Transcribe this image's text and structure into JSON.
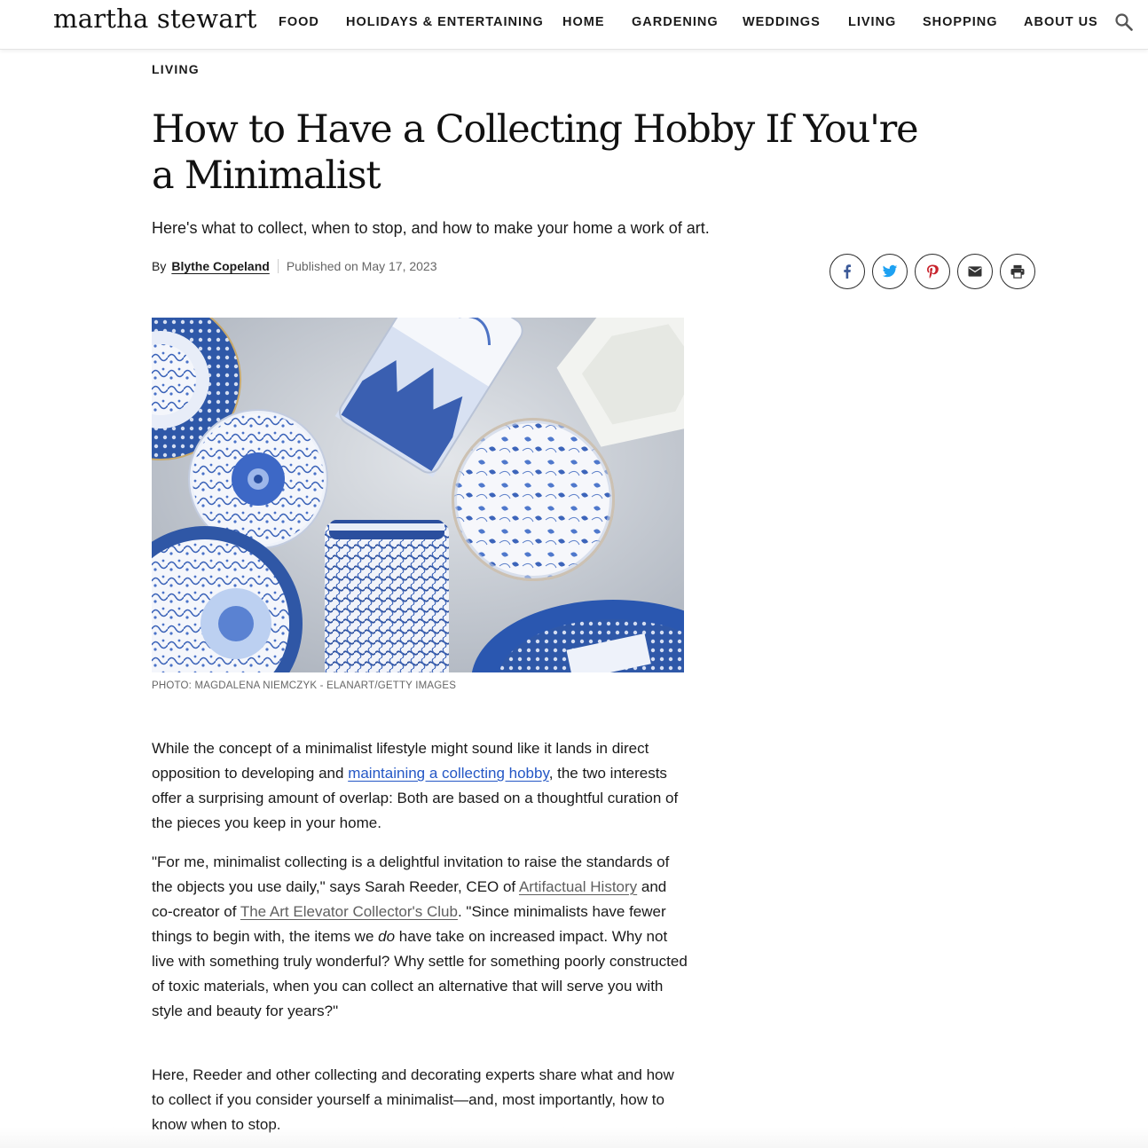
{
  "header": {
    "logo": "martha stewart",
    "nav": [
      {
        "label": "FOOD"
      },
      {
        "label": "HOLIDAYS & ENTERTAINING"
      },
      {
        "label": "HOME"
      },
      {
        "label": "GARDENING"
      },
      {
        "label": "WEDDINGS"
      },
      {
        "label": "LIVING"
      },
      {
        "label": "SHOPPING"
      },
      {
        "label": "ABOUT US"
      }
    ],
    "search_icon": "search-icon"
  },
  "article": {
    "kicker": "LIVING",
    "title": "How to Have a Collecting Hobby If You're a Minimalist",
    "dek": "Here's what to collect, when to stop, and how to make your home a work of art.",
    "byline": {
      "by": "By",
      "author": "Blythe Copeland",
      "published": "Published on May 17, 2023"
    },
    "share_icons": [
      "facebook-icon",
      "twitter-icon",
      "pinterest-icon",
      "email-icon",
      "print-icon"
    ],
    "photo_credit": "PHOTO: MAGDALENA NIEMCZYK - ELANART/GETTY IMAGES",
    "p1": {
      "before": "While the concept of a minimalist lifestyle might sound like it lands in direct opposition to developing and ",
      "link": "maintaining a collecting hobby",
      "after": ", the two interests offer a surprising amount of overlap: Both are based on a thoughtful curation of the pieces you keep in your home."
    },
    "p2": {
      "t1": "\"For me, minimalist collecting is a delightful invitation to raise the standards of the objects you use daily,\" says Sarah Reeder, CEO of ",
      "link1": "Artifactual History",
      "t2": " and co-creator of ",
      "link2": "The Art Elevator Collector's Club",
      "t3": ". \"Since minimalists have fewer things to begin with, the items we ",
      "em": "do",
      "t4": " have take on increased impact. Why not live with something truly wonderful? Why settle for something poorly constructed of toxic materials, when you can collect an alternative that will serve you with style and beauty for years?\""
    },
    "p3": "Here, Reeder and other collecting and decorating experts share what and how to collect if you consider yourself a minimalist—and, most importantly, how to know when to stop."
  },
  "colors": {
    "link_blue": "#2457c5",
    "pinterest_red": "#c8232c",
    "facebook_blue": "#3b5998",
    "twitter_blue": "#1da1f2"
  }
}
